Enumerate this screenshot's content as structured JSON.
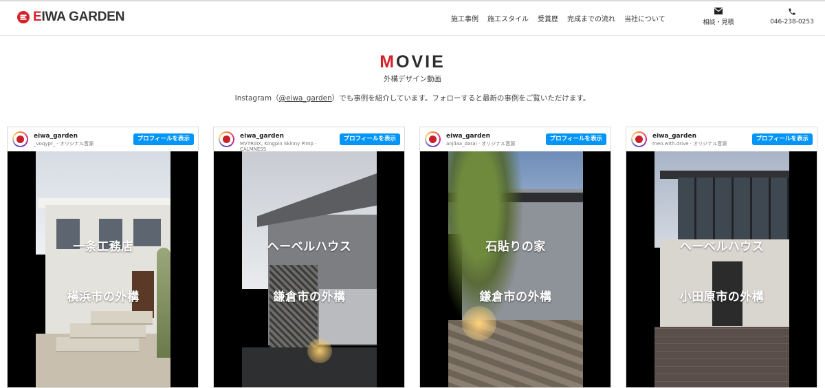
{
  "header": {
    "logo_mark": "EIWA",
    "logo_text_e": "E",
    "logo_text_rest": "IWA GARDEN",
    "nav": [
      {
        "label": "施工事例"
      },
      {
        "label": "施工スタイル"
      },
      {
        "label": "受賞歴"
      },
      {
        "label": "完成までの流れ"
      },
      {
        "label": "当社について"
      }
    ],
    "contact_mail": {
      "icon": "mail-icon",
      "label": "相談・見積"
    },
    "contact_phone": {
      "icon": "phone-icon",
      "label": "046-238-0253"
    }
  },
  "section": {
    "title_first": "M",
    "title_rest": "OVIE",
    "subtitle": "外構デザイン動画",
    "intro_before": "Instagram（",
    "intro_handle": "@eiwa_garden",
    "intro_after": "）でも事例を紹介しています。フォローすると最新の事例をご覧いただけます。"
  },
  "posts": [
    {
      "username": "eiwa_garden",
      "audio": "_voqypr_ · オリジナル音源",
      "button": "プロフィールを表示",
      "caption_1": "一条工務店",
      "caption_2": "横浜市の外構"
    },
    {
      "username": "eiwa_garden",
      "audio": "MVTRIIIX, Kingpin Skinny Pimp · CALMNESS",
      "button": "プロフィールを表示",
      "caption_1": "ヘーベルハウス",
      "caption_2": "鎌倉市の外構"
    },
    {
      "username": "eiwa_garden",
      "audio": "anjilaa_darai · オリジナル音源",
      "button": "プロフィールを表示",
      "caption_1": "石貼りの家",
      "caption_2": "鎌倉市の外構"
    },
    {
      "username": "eiwa_garden",
      "audio": "men.with.drive · オリジナル音源",
      "button": "プロフィールを表示",
      "caption_1": "ヘーベルハウス",
      "caption_2": "小田原市の外構"
    }
  ],
  "colors": {
    "brand_red": "#d5222a",
    "instagram_blue": "#0095f6",
    "text": "#333333"
  }
}
